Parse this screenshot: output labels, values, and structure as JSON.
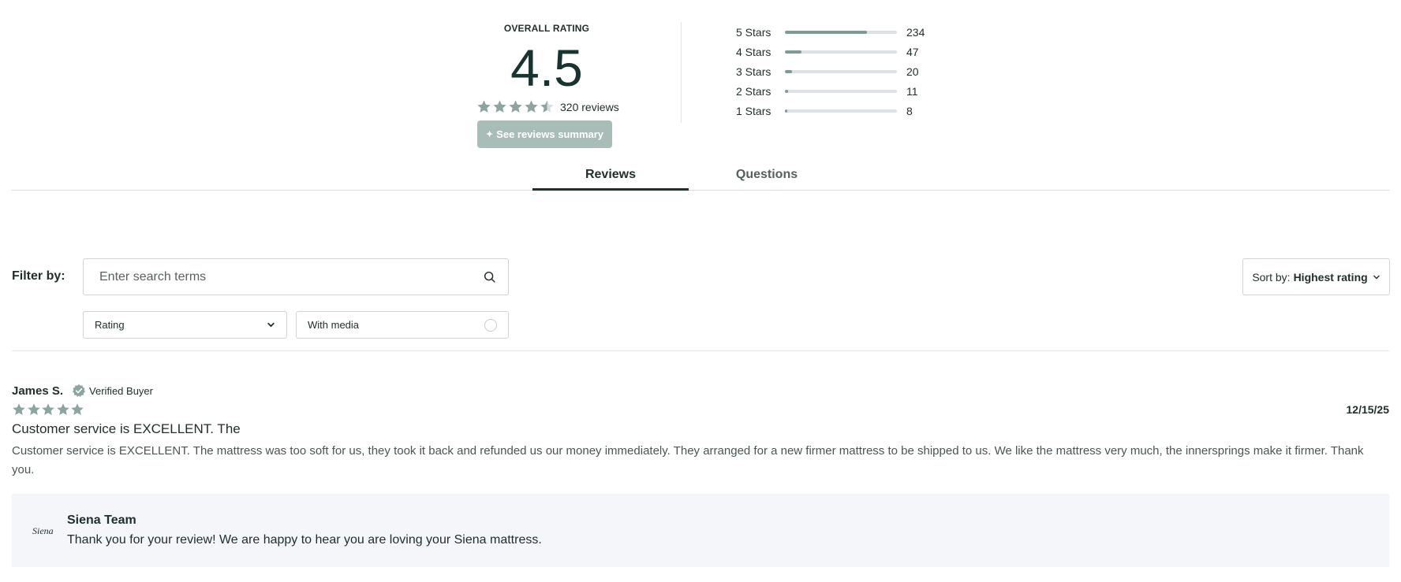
{
  "summary": {
    "overall_title": "OVERALL RATING",
    "score": "4.5",
    "average_stars": 4.5,
    "reviews_count": "320 reviews",
    "summary_button_icon": "sparkle-icon",
    "summary_button_label": "See reviews summary",
    "histogram": [
      {
        "label": "5 Stars",
        "count": "234",
        "fraction": 0.73
      },
      {
        "label": "4 Stars",
        "count": "47",
        "fraction": 0.15
      },
      {
        "label": "3 Stars",
        "count": "20",
        "fraction": 0.06
      },
      {
        "label": "2 Stars",
        "count": "11",
        "fraction": 0.03
      },
      {
        "label": "1 Stars",
        "count": "8",
        "fraction": 0.02
      }
    ]
  },
  "tabs": {
    "reviews": "Reviews",
    "questions": "Questions",
    "active": "Reviews"
  },
  "filters": {
    "label": "Filter by:",
    "search_placeholder": "Enter search terms",
    "search_value": "",
    "rating_label": "Rating",
    "media_label": "With media",
    "sort_prefix": "Sort by:",
    "sort_value": "Highest rating"
  },
  "review": {
    "author": "James S.",
    "verified": "Verified Buyer",
    "stars": 5,
    "date": "12/15/25",
    "title": "Customer service is EXCELLENT. The",
    "body": "Customer service is EXCELLENT. The mattress was too soft for us, they took it back and refunded us our money immediately. They arranged for a new firmer mattress to be shipped to us. We like the mattress very much, the innersprings make it firmer. Thank you.",
    "reply": {
      "logo": "Siena",
      "name": "Siena Team",
      "text": "Thank you for your review! We are happy to hear you are loving your Siena mattress."
    }
  },
  "colors": {
    "star": "#8ca5a1",
    "star_empty": "#d9dfde",
    "accent": "#183330",
    "button_bg": "#a9bdb8",
    "bar_fill": "#7d9a95",
    "bar_track": "#dde0e4",
    "reply_bg": "#f4f6f9"
  }
}
